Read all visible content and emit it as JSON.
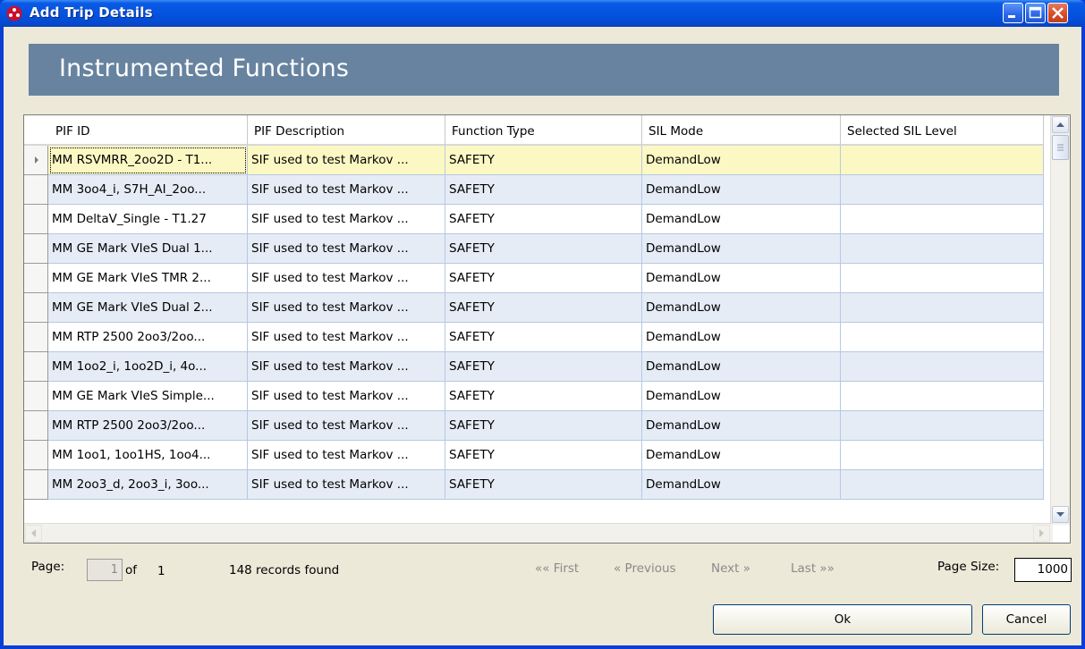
{
  "window": {
    "title": "Add Trip Details"
  },
  "banner": {
    "title": "Instrumented Functions"
  },
  "grid": {
    "columns": [
      "PIF ID",
      "PIF Description",
      "Function Type",
      "SIL Mode",
      "Selected SIL Level"
    ],
    "rows": [
      [
        "MM RSVMRR_2oo2D - T1...",
        "SIF used to test Markov ...",
        "SAFETY",
        "DemandLow",
        ""
      ],
      [
        "MM 3oo4_i, S7H_AI_2oo...",
        "SIF used to test Markov ...",
        "SAFETY",
        "DemandLow",
        ""
      ],
      [
        "MM DeltaV_Single - T1.27",
        "SIF used to test Markov ...",
        "SAFETY",
        "DemandLow",
        ""
      ],
      [
        "MM GE Mark VIeS Dual 1...",
        "SIF used to test Markov ...",
        "SAFETY",
        "DemandLow",
        ""
      ],
      [
        "MM GE Mark VIeS TMR 2...",
        "SIF used to test Markov ...",
        "SAFETY",
        "DemandLow",
        ""
      ],
      [
        "MM GE Mark VIeS Dual 2...",
        "SIF used to test Markov ...",
        "SAFETY",
        "DemandLow",
        ""
      ],
      [
        "MM RTP 2500 2oo3/2oo...",
        "SIF used to test Markov ...",
        "SAFETY",
        "DemandLow",
        ""
      ],
      [
        "MM 1oo2_i, 1oo2D_i, 4o...",
        "SIF used to test Markov ...",
        "SAFETY",
        "DemandLow",
        ""
      ],
      [
        "MM GE Mark VIeS Simple...",
        "SIF used to test Markov ...",
        "SAFETY",
        "DemandLow",
        ""
      ],
      [
        "MM RTP 2500 2oo3/2oo...",
        "SIF used to test Markov ...",
        "SAFETY",
        "DemandLow",
        ""
      ],
      [
        "MM 1oo1, 1oo1HS, 1oo4...",
        "SIF used to test Markov ...",
        "SAFETY",
        "DemandLow",
        ""
      ],
      [
        "MM 2oo3_d, 2oo3_i, 3oo...",
        "SIF used to test Markov ...",
        "SAFETY",
        "DemandLow",
        ""
      ]
    ]
  },
  "pager": {
    "page_label": "Page:",
    "page_value": "1",
    "of_label": "of",
    "total_pages": "1",
    "records": "148 records found",
    "first": "«« First",
    "previous": "« Previous",
    "next": "Next »",
    "last": "Last »»",
    "page_size_label": "Page Size:",
    "page_size_value": "1000"
  },
  "buttons": {
    "ok": "Ok",
    "cancel": "Cancel"
  }
}
